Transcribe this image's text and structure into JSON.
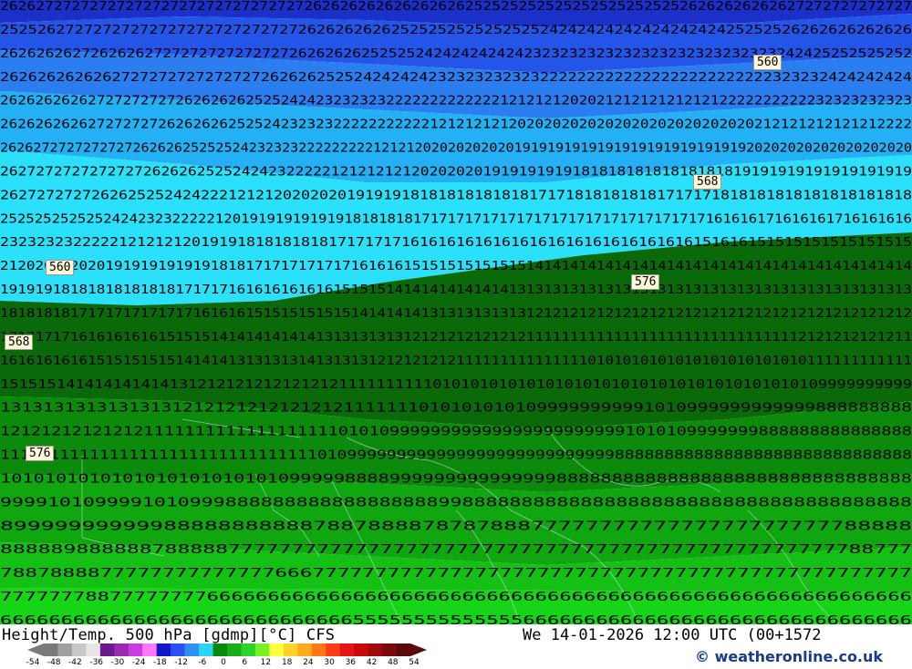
{
  "map": {
    "bands": [
      {
        "color": "#1a30c8"
      },
      {
        "color": "#2255e8"
      },
      {
        "color": "#2a7ef0"
      },
      {
        "color": "#24b0f4"
      },
      {
        "color": "#2ae0fa"
      },
      {
        "color": "#0a6a0a"
      },
      {
        "color": "#0b8a0b"
      },
      {
        "color": "#0fa60f"
      },
      {
        "color": "#14c014"
      },
      {
        "color": "#16d416"
      }
    ],
    "rows": [
      "262627272727272727272727272727272726262626262626262625252525252525252525252526262626262627272727272727",
      "25252627272727272727272727272727262626262625252525252525252424242424242424242425252526262626262626",
      "26262626272626262727272727272727262626262525252424242424242323232323232323232323232323242425252525252",
      "26262626262627272727272727272626262525242424242323232323232222222222222222222222222323232424242424",
      "26262626262727272727262626262525242423232323222222222222212121212020212121212121212222222222232323232323",
      "26262626262727272726262626252524232323222222222221212121212020202020202020202020202020212121212121212222",
      "26262727272727272626262525252423232322222222212121202020202020191919191919191919191919191920202020202020202020",
      "262727272727272726262625252424232222212121212120202020191919191918181818181818181819191919191919191919",
      "2627272727262625252424222121212020202019191918181818181818171718181818181717171818181818181818181818",
      "2525252525252424232322222120191919191919181818181717171717171717171717171717171717161616171616161716161616",
      "2323232322222121212120191918181818181717171716161616161616161616161616161616151616151515151515151515",
      "21202020202019191919191918181717171717171616161515151515151514141414141414141414141414141414141414141414",
      "19191918181818181818171717161616161616151515141414141414141313131313131313131313131313131313131313131313",
      "18181818171717171717171616161515151515151414141413131313131312121212121212121212121212121212121212121212",
      "17171717161616161615151514141414141413131313131212121212121211111111111111111111111111111112121212121211",
      "16161616161515151515141414131313131413131312121212121111111111111110101010101010101010101010111111111111",
      "1515151414141414141312121212121212121111111111010101010101010101010101010101010101010109999999999",
      "1313131313131313121212121212121211111110101010101099999999991010999999999999888888888",
      "12121212121212111111111111111111101010999999999999999999999991010109999999888888888888888",
      "11111111111111111111111111111111010999999999999999999999999999888888888888888888888888888888",
      "1010101010101010101010101099999888899999999999999988888888888888888888888888888888",
      "99991010999910109998888888888888888889988888888888888888888888888888888888888",
      "8999999999998888888888878878888787878887777777777777777777777788888",
      "888889888888788888777777777777777777777777777777777777777777777777788777",
      "7887888877777777777777666777777777777777777777777777777777777777777777777",
      "777777788777777776666666666666666666666666666666666666666666666666666666666",
      "666666666666666666666666666665555555555555566666666666666666666666666666666"
    ],
    "contour_labels": [
      "560",
      "568",
      "576",
      "560",
      "568",
      "576"
    ]
  },
  "footer": {
    "title": "Height/Temp. 500 hPa [gdmp][°C] CFS",
    "datetime": "We 14-01-2026 12:00 UTC (00+1572",
    "credit": "© weatheronline.co.uk",
    "scale_ticks": [
      "-54",
      "-48",
      "-42",
      "-36",
      "-30",
      "-24",
      "-18",
      "-12",
      "-6",
      "0",
      "6",
      "12",
      "18",
      "24",
      "30",
      "36",
      "42",
      "48",
      "54"
    ],
    "scale_colors": [
      "#7a7a7a",
      "#a0a0a0",
      "#c8c8c8",
      "#e6e6e6",
      "#6a1a8a",
      "#9a2ab0",
      "#c83ce0",
      "#ff78ff",
      "#1414c8",
      "#2a50f0",
      "#2a90f4",
      "#2ad4f4",
      "#0a8a0a",
      "#16b016",
      "#2ad42a",
      "#78f028",
      "#ffff3c",
      "#ffd228",
      "#ffaa1e",
      "#ff7814",
      "#ff3c14",
      "#e61414",
      "#c80a0a",
      "#a00a0a",
      "#7a0a0a",
      "#5a0a0a"
    ]
  }
}
